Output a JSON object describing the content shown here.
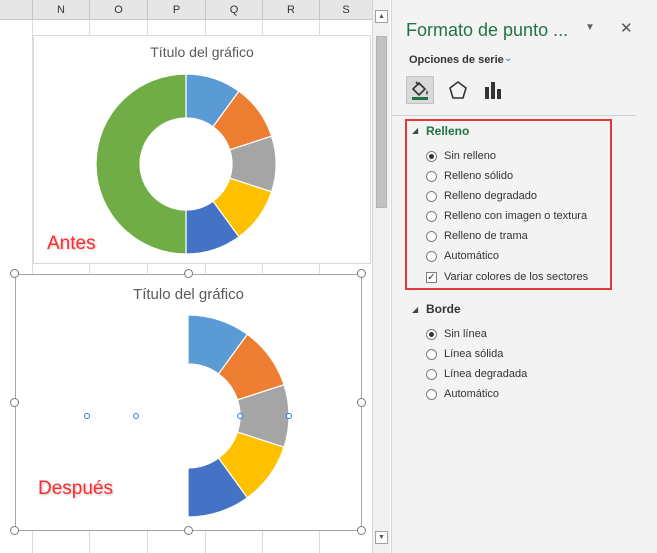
{
  "sheet": {
    "columns": [
      "N",
      "O",
      "P",
      "Q",
      "R",
      "S"
    ]
  },
  "chart_before": {
    "title": "Título del gráfico",
    "annotation": "Antes"
  },
  "chart_after": {
    "title": "Título del gráfico",
    "annotation": "Después"
  },
  "chart_data": [
    {
      "type": "pie",
      "subtype": "doughnut",
      "title": "Título del gráfico",
      "values": [
        1,
        1,
        1,
        1,
        1,
        5
      ],
      "colors": [
        "#5b9bd5",
        "#ed7d31",
        "#a5a5a5",
        "#ffc000",
        "#4472c4",
        "#70ad47"
      ],
      "start_angle_deg": 270,
      "grid": false,
      "legend": "none"
    },
    {
      "type": "pie",
      "subtype": "doughnut",
      "title": "Título del gráfico",
      "values": [
        1,
        1,
        1,
        1,
        1,
        5
      ],
      "colors": [
        "#5b9bd5",
        "#ed7d31",
        "#a5a5a5",
        "#ffc000",
        "#4472c4",
        "none"
      ],
      "start_angle_deg": 270,
      "grid": false,
      "legend": "none",
      "note_selected_point": "no fill"
    }
  ],
  "pane": {
    "title": "Formato de punto ...",
    "series_options": "Opciones de serie",
    "tabs": [
      {
        "icon": "fill-bucket-icon",
        "active": true
      },
      {
        "icon": "pentagon-icon",
        "active": false
      },
      {
        "icon": "bar-chart-icon",
        "active": false
      }
    ],
    "fill": {
      "heading": "Relleno",
      "options": [
        {
          "label": "Sin relleno",
          "selected": true
        },
        {
          "label": "Relleno sólido",
          "selected": false
        },
        {
          "label": "Relleno degradado",
          "selected": false
        },
        {
          "label": "Relleno con imagen o textura",
          "selected": false
        },
        {
          "label": "Relleno de trama",
          "selected": false
        },
        {
          "label": "Automático",
          "selected": false
        }
      ],
      "vary_colors": {
        "label": "Variar colores de los sectores",
        "checked": true
      }
    },
    "border": {
      "heading": "Borde",
      "options": [
        {
          "label": "Sin línea",
          "selected": true
        },
        {
          "label": "Línea sólida",
          "selected": false
        },
        {
          "label": "Línea degradada",
          "selected": false
        },
        {
          "label": "Automático",
          "selected": false
        }
      ]
    },
    "accent_color": "#217346",
    "highlight_color": "#e03a3a"
  }
}
